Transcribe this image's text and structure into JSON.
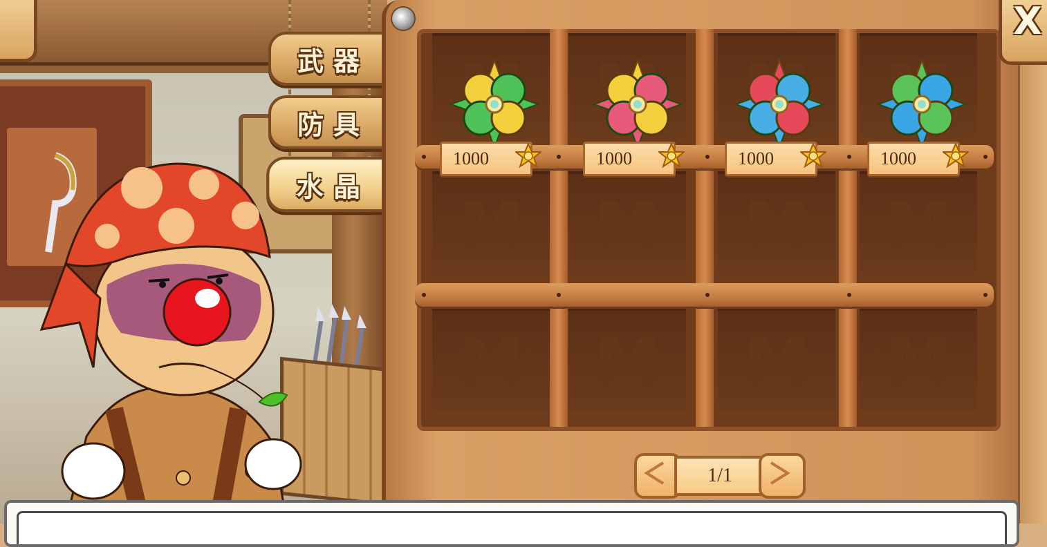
{
  "tabs": [
    {
      "label": "武器",
      "active": false
    },
    {
      "label": "防具",
      "active": false
    },
    {
      "label": "水晶",
      "active": true
    }
  ],
  "close": {
    "label": "X"
  },
  "shop_items": [
    {
      "icon": "yellow-green-crystal-icon",
      "price": "1000",
      "colors": [
        "#f4d03c",
        "#4fc35a"
      ]
    },
    {
      "icon": "pink-yellow-crystal-icon",
      "price": "1000",
      "colors": [
        "#f4d03c",
        "#e85a7a"
      ]
    },
    {
      "icon": "red-blue-crystal-icon",
      "price": "1000",
      "colors": [
        "#e64a5a",
        "#4aaee6"
      ]
    },
    {
      "icon": "green-blue-crystal-icon",
      "price": "1000",
      "colors": [
        "#5ac35a",
        "#3aa6e6"
      ]
    }
  ],
  "empty_slot_mark": "M",
  "pager": {
    "label": "1/1"
  }
}
